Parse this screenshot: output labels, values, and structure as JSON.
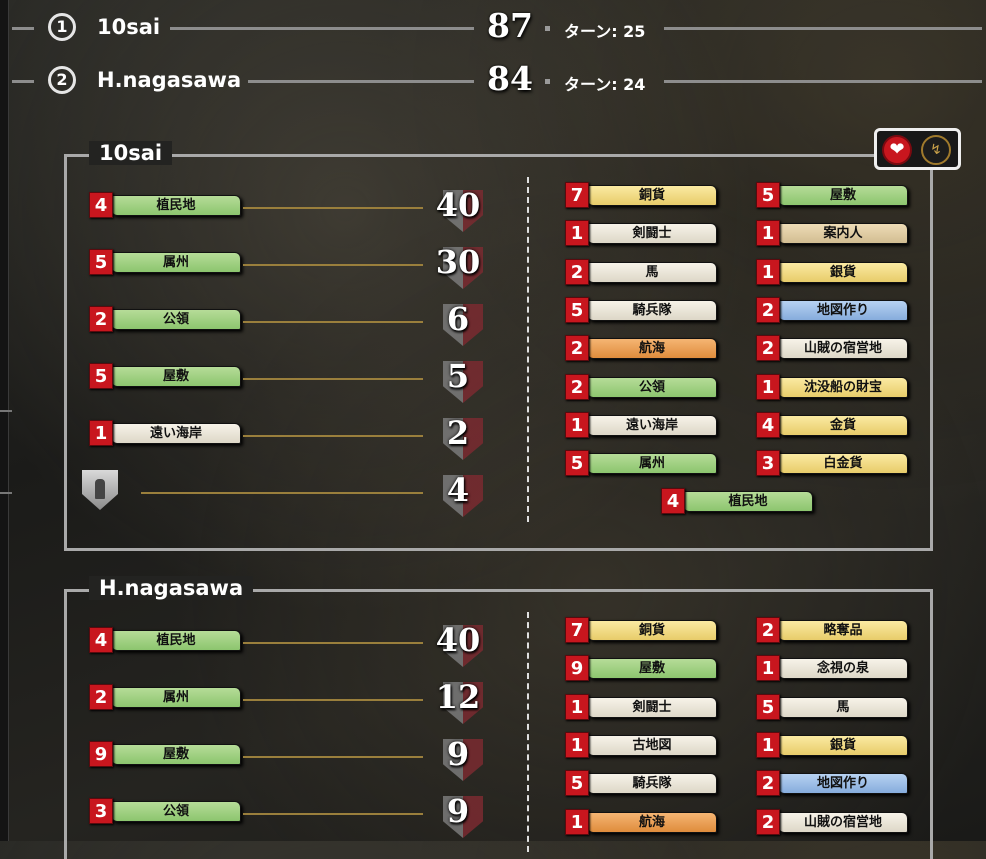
{
  "summary": [
    {
      "rank": "1",
      "name": "10sai",
      "score": "87",
      "turn": "ターン: 25"
    },
    {
      "rank": "2",
      "name": "H.nagasawa",
      "score": "84",
      "turn": "ターン: 24"
    }
  ],
  "players": [
    {
      "name": "10sai",
      "scores": [
        {
          "count": "4",
          "card": "植民地",
          "color": "green",
          "vp": "40"
        },
        {
          "count": "5",
          "card": "属州",
          "color": "green",
          "vp": "30"
        },
        {
          "count": "2",
          "card": "公領",
          "color": "green",
          "vp": "6"
        },
        {
          "count": "5",
          "card": "屋敷",
          "color": "green",
          "vp": "5"
        },
        {
          "count": "1",
          "card": "遠い海岸",
          "color": "white",
          "vp": "2"
        }
      ],
      "token_vp": "4",
      "deck_left": [
        {
          "count": "7",
          "card": "銅貨",
          "color": "gold"
        },
        {
          "count": "1",
          "card": "剣闘士",
          "color": "white"
        },
        {
          "count": "2",
          "card": "馬",
          "color": "white"
        },
        {
          "count": "5",
          "card": "騎兵隊",
          "color": "white"
        },
        {
          "count": "2",
          "card": "航海",
          "color": "orange"
        },
        {
          "count": "2",
          "card": "公領",
          "color": "green"
        },
        {
          "count": "1",
          "card": "遠い海岸",
          "color": "white"
        },
        {
          "count": "5",
          "card": "属州",
          "color": "green"
        }
      ],
      "deck_right": [
        {
          "count": "5",
          "card": "屋敷",
          "color": "green"
        },
        {
          "count": "1",
          "card": "案内人",
          "color": "tan"
        },
        {
          "count": "1",
          "card": "銀貨",
          "color": "gold"
        },
        {
          "count": "2",
          "card": "地図作り",
          "color": "blue"
        },
        {
          "count": "2",
          "card": "山賊の宿営地",
          "color": "white"
        },
        {
          "count": "1",
          "card": "沈没船の財宝",
          "color": "gold"
        },
        {
          "count": "4",
          "card": "金貨",
          "color": "gold"
        },
        {
          "count": "3",
          "card": "白金貨",
          "color": "gold"
        }
      ],
      "deck_bottom": {
        "count": "4",
        "card": "植民地",
        "color": "green"
      }
    },
    {
      "name": "H.nagasawa",
      "scores": [
        {
          "count": "4",
          "card": "植民地",
          "color": "green",
          "vp": "40"
        },
        {
          "count": "2",
          "card": "属州",
          "color": "green",
          "vp": "12"
        },
        {
          "count": "9",
          "card": "屋敷",
          "color": "green",
          "vp": "9"
        },
        {
          "count": "3",
          "card": "公領",
          "color": "green",
          "vp": "9"
        }
      ],
      "deck_left": [
        {
          "count": "7",
          "card": "銅貨",
          "color": "gold"
        },
        {
          "count": "9",
          "card": "屋敷",
          "color": "green"
        },
        {
          "count": "1",
          "card": "剣闘士",
          "color": "white"
        },
        {
          "count": "1",
          "card": "古地図",
          "color": "white"
        },
        {
          "count": "5",
          "card": "騎兵隊",
          "color": "white"
        },
        {
          "count": "1",
          "card": "航海",
          "color": "orange"
        }
      ],
      "deck_right": [
        {
          "count": "2",
          "card": "略奪品",
          "color": "gold"
        },
        {
          "count": "1",
          "card": "念視の泉",
          "color": "white"
        },
        {
          "count": "5",
          "card": "馬",
          "color": "white"
        },
        {
          "count": "1",
          "card": "銀貨",
          "color": "gold"
        },
        {
          "count": "2",
          "card": "地図作り",
          "color": "blue"
        },
        {
          "count": "2",
          "card": "山賊の宿営地",
          "color": "white"
        }
      ]
    }
  ],
  "icons": {
    "heart": "heart-icon",
    "bolt": "lightning-icon",
    "shield": "vp-token-shield-icon"
  },
  "colors": {
    "count_badge": "#c8161e",
    "panel_border": "#a9a9a9",
    "score_line": "#9a7f3c"
  }
}
